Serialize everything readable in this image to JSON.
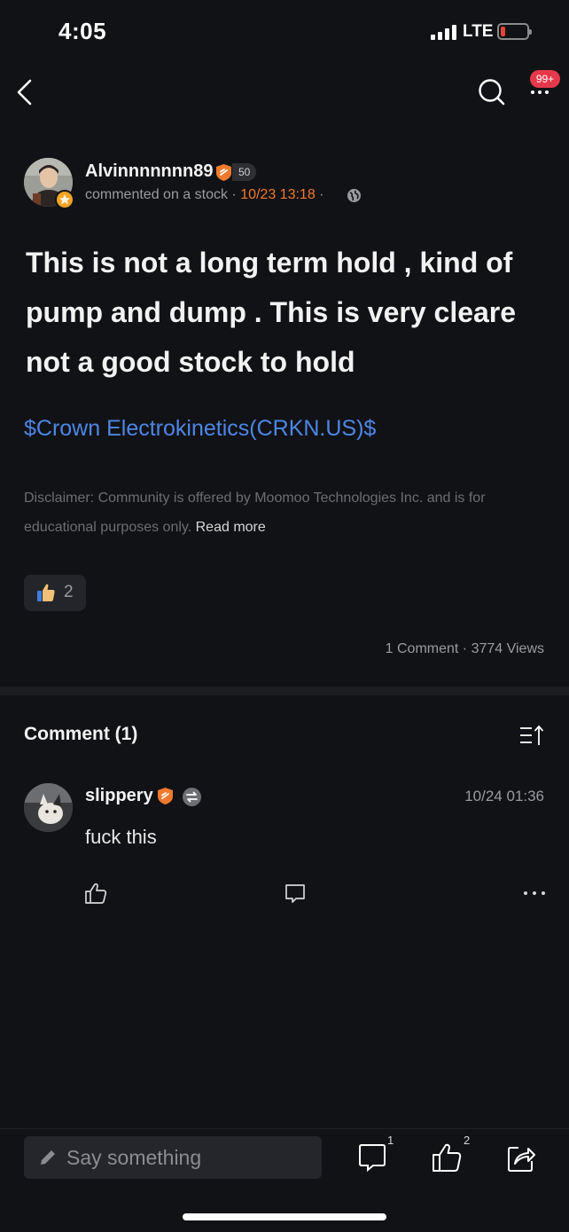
{
  "status": {
    "time": "4:05",
    "network": "LTE"
  },
  "nav": {
    "notification_badge": "99+"
  },
  "post": {
    "author": "Alvinnnnnnn89",
    "level": "50",
    "action": "commented on a stock",
    "separator": " · ",
    "time": "10/23 13:18",
    "body": "This is not a long term hold , kind of pump and dump . This is very cleare not a good stock to hold",
    "stock_link": "$Crown Electrokinetics(CRKN.US)$",
    "disclaimer": "Disclaimer: Community is offered by Moomoo Technologies Inc. and is for educational purposes only.",
    "read_more": "Read more",
    "like_count": "2",
    "stats": "1 Comment · 3774 Views"
  },
  "comments": {
    "title": "Comment (1)",
    "items": [
      {
        "author": "slippery",
        "time": "10/24 01:36",
        "text": "fuck this"
      }
    ]
  },
  "bottom_bar": {
    "placeholder": "Say something",
    "comment_count": "1",
    "like_count": "2"
  },
  "colors": {
    "background": "#111215",
    "link_blue": "#4d86e6",
    "timestamp_orange": "#ef7a2c",
    "badge_red": "#e5384a"
  },
  "icons": [
    "back-icon",
    "search-icon",
    "more-icon",
    "globe-icon",
    "thumbs-up-icon",
    "sort-icon",
    "comment-icon",
    "pencil-icon",
    "share-icon"
  ]
}
